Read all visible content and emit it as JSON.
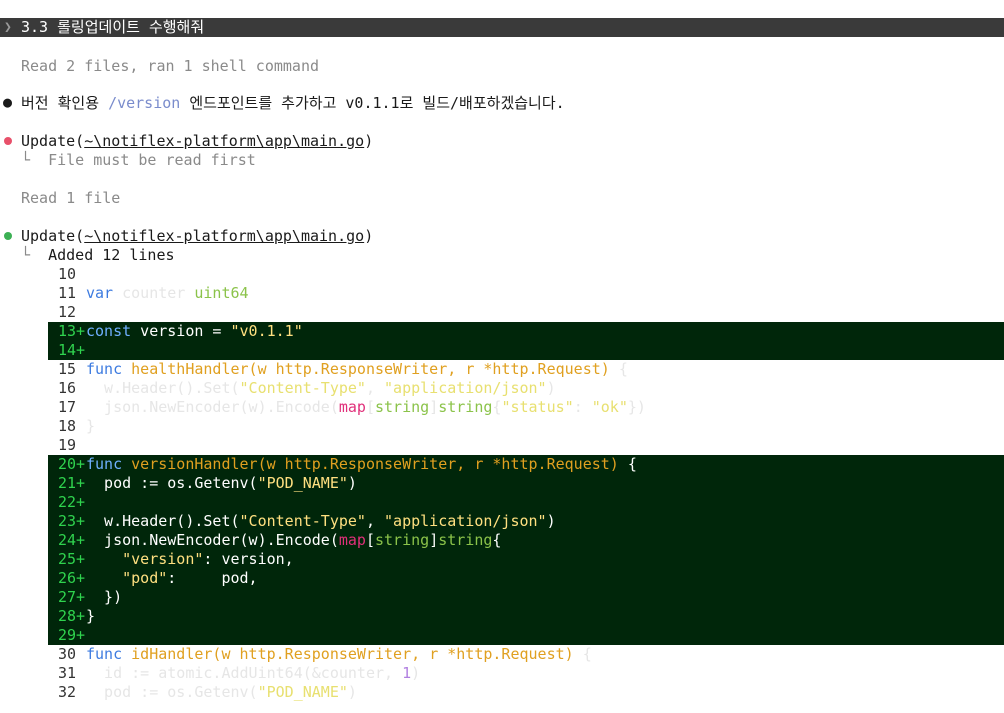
{
  "prompt": {
    "text": "3.3 롤링업데이트 수행해줘"
  },
  "status1": "Read 2 files, ran 1 shell command",
  "message": {
    "before": "버전 확인용 ",
    "route": "/version",
    "after": " 엔드포인트를 추가하고 v0.1.1로 빌드/배포하겠습니다."
  },
  "update1": {
    "label": "Update(",
    "path": "~\\notiflex-platform\\app\\main.go",
    "close": ")",
    "result": "File must be read first",
    "dot_color": "#e8506a"
  },
  "status2": "Read 1 file",
  "update2": {
    "label": "Update(",
    "path": "~\\notiflex-platform\\app\\main.go",
    "close": ")",
    "result": "Added 12 lines",
    "dot_color": "#3cb054"
  },
  "tree_char": "└",
  "diff": {
    "l10": "10",
    "l11": "11",
    "l12": "12",
    "l13": "13",
    "l14": "14",
    "l15": "15",
    "l16": "16",
    "l17": "17",
    "l18": "18",
    "l19": "19",
    "l20": "20",
    "l21": "21",
    "l22": "22",
    "l23": "23",
    "l24": "24",
    "l25": "25",
    "l26": "26",
    "l27": "27",
    "l28": "28",
    "l29": "29",
    "l30": "30",
    "l31": "31",
    "l32": "32",
    "plus": "+",
    "c11a": "var",
    "c11b": " counter ",
    "c11c": "uint64",
    "c13a": "const",
    "c13b": " version = ",
    "c13c": "\"v0.1.1\"",
    "c15a": "func",
    "c15b": " healthHandler(",
    "c15c": "w",
    "c15d": " http.ResponseWriter",
    "c15e": ", ",
    "c15f": "r",
    "c15g": " *http.Request)",
    "c15h": " {",
    "c16a": "  w.Header().Set(",
    "c16b": "\"Content-Type\"",
    "c16c": ", ",
    "c16d": "\"application/json\"",
    "c16e": ")",
    "c17a": "  json.NewEncoder(w).Encode(",
    "c17b": "map",
    "c17c": "[",
    "c17d": "string",
    "c17e": "]",
    "c17f": "string",
    "c17g": "{",
    "c17h": "\"status\"",
    "c17i": ": ",
    "c17j": "\"ok\"",
    "c17k": "})",
    "c18": "}",
    "c20a": "func",
    "c20b": " versionHandler(",
    "c20c": "w",
    "c20d": " http.ResponseWriter",
    "c20e": ", ",
    "c20f": "r",
    "c20g": " *http.Request)",
    "c20h": " {",
    "c21a": "  pod := os.Getenv(",
    "c21b": "\"POD_NAME\"",
    "c21c": ")",
    "c23a": "  w.Header().Set(",
    "c23b": "\"Content-Type\"",
    "c23c": ", ",
    "c23d": "\"application/json\"",
    "c23e": ")",
    "c24a": "  json.NewEncoder(w).Encode(",
    "c24b": "map",
    "c24c": "[",
    "c24d": "string",
    "c24e": "]",
    "c24f": "string",
    "c24g": "{",
    "c25a": "    ",
    "c25b": "\"version\"",
    "c25c": ": version,",
    "c26a": "    ",
    "c26b": "\"pod\"",
    "c26c": ":     pod,",
    "c27": "  })",
    "c28": "}",
    "c30a": "func",
    "c30b": " idHandler(",
    "c30c": "w",
    "c30d": " http.ResponseWriter",
    "c30e": ", ",
    "c30f": "r",
    "c30g": " *http.Request)",
    "c30h": " {",
    "c31a": "  id := atomic.AddUint64(&counter, ",
    "c31b": "1",
    "c31c": ")",
    "c32a": "  pod := os.Getenv(",
    "c32b": "\"POD_NAME\"",
    "c32c": ")"
  }
}
